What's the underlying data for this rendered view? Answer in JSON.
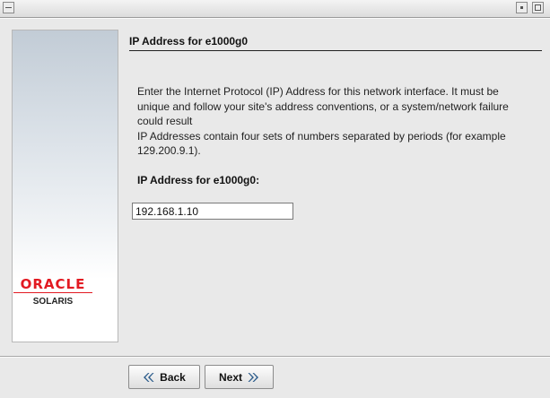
{
  "window": {
    "title": ""
  },
  "sidebar": {
    "logo_text": "ORACLE",
    "product_text": "SOLARIS",
    "logo_color": "#e21a22"
  },
  "main": {
    "heading": "IP Address for e1000g0",
    "description_lines": [
      "Enter the Internet Protocol (IP) Address for this network interface.  It must be",
      "unique and follow your site's address conventions, or a system/network failure",
      "could result",
      "IP Addresses contain four sets of numbers separated by periods (for example",
      "129.200.9.1)."
    ],
    "field_label": "IP Address for e1000g0:",
    "ip_value": "192.168.1.10"
  },
  "footer": {
    "back_label": "Back",
    "next_label": "Next"
  }
}
